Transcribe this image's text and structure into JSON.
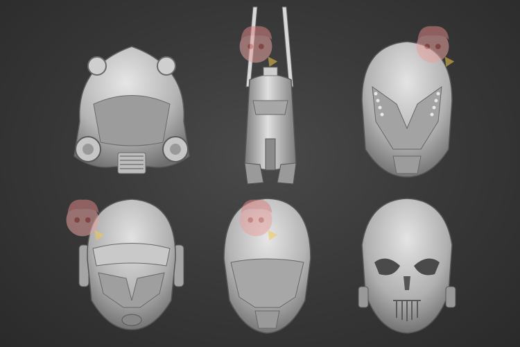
{
  "scene": {
    "background_color": "#3a3a3a",
    "model_color": "#b9b9b9",
    "watermark_colors": [
      "#e59a9a",
      "#f2c94c"
    ],
    "models": [
      {
        "name": "helmet-front-visor-with-filters"
      },
      {
        "name": "helmet-side-profile-with-antennas"
      },
      {
        "name": "helmet-front-angular-faceplate"
      },
      {
        "name": "helmet-front-goggle-visor"
      },
      {
        "name": "helmet-front-smooth-dome"
      },
      {
        "name": "helmet-front-skull-mask"
      }
    ],
    "watermark_icon": "anime-girl-watermark-icon"
  }
}
